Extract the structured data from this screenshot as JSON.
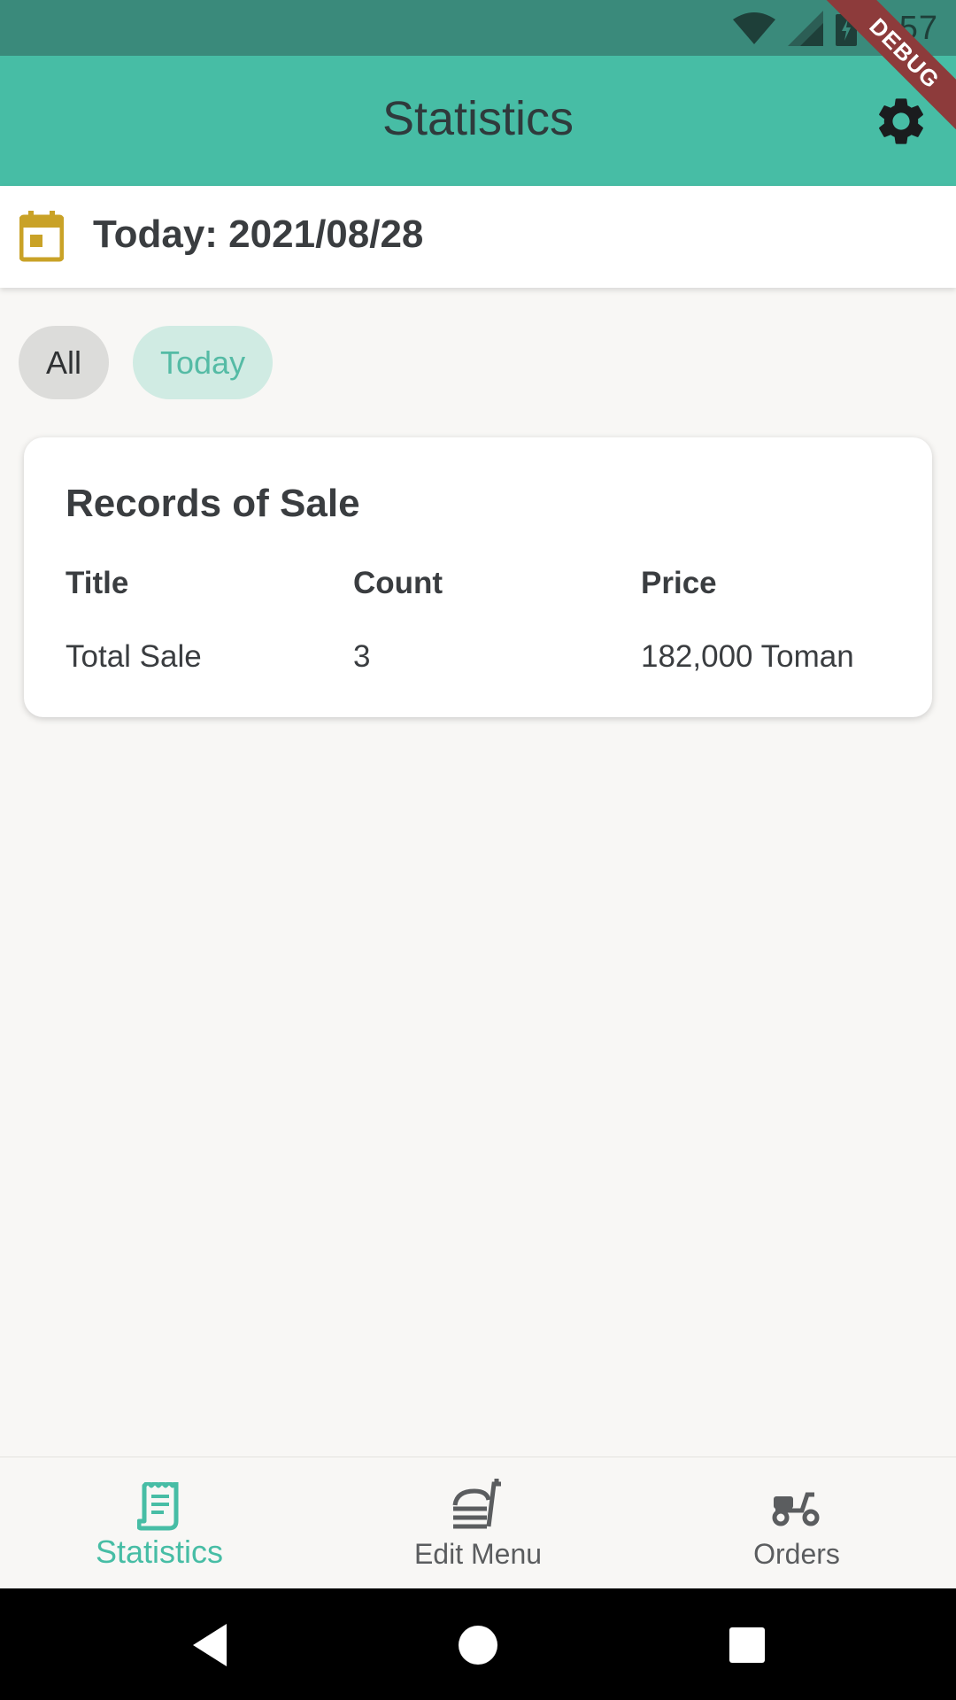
{
  "status_bar": {
    "time": "1:57",
    "background": "#3a8a7b",
    "icons": [
      "wifi-icon",
      "cellular-signal-icon",
      "battery-charging-icon"
    ]
  },
  "debug_banner": "DEBUG",
  "app_bar": {
    "title": "Statistics",
    "background": "#47bda5",
    "settings_icon": "gear-icon"
  },
  "date_header": {
    "icon": "calendar-icon",
    "icon_color": "#c9a227",
    "text": "Today: 2021/08/28"
  },
  "filters": {
    "selected": "Today",
    "options": [
      {
        "label": "All"
      },
      {
        "label": "Today"
      }
    ]
  },
  "sales_card": {
    "title": "Records of Sale",
    "columns": [
      "Title",
      "Count",
      "Price"
    ],
    "rows": [
      {
        "title": "Total Sale",
        "count": "3",
        "price": "182,000 Toman"
      }
    ]
  },
  "bottom_nav": {
    "active_color": "#47bda5",
    "items": [
      {
        "label": "Statistics",
        "icon": "receipt-icon",
        "active": true
      },
      {
        "label": "Edit Menu",
        "icon": "food-tray-icon",
        "active": false
      },
      {
        "label": "Orders",
        "icon": "delivery-scooter-icon",
        "active": false
      }
    ]
  },
  "system_nav": {
    "buttons": [
      "back-icon",
      "home-icon",
      "recents-icon"
    ]
  }
}
